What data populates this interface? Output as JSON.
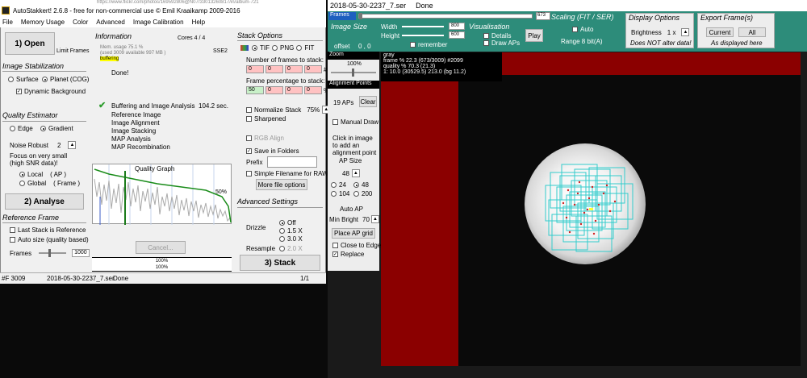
{
  "left": {
    "url_text": "https://www.flickr.com/photos/169592806@N07/33013260817/in/album-721",
    "title": "AutoStakkert! 2.6.8 - free for non-commercial use © Emil Kraaikamp 2009-2016",
    "menu": [
      "File",
      "Memory Usage",
      "Color",
      "Advanced",
      "Image Calibration",
      "Help"
    ],
    "open_label": "1) Open",
    "limit_frames_label": "Limit Frames",
    "stabilization": {
      "header": "Image Stabilization",
      "surface": "Surface",
      "planet": "Planet (COG)",
      "dynamic_bg": "Dynamic Background"
    },
    "quality": {
      "header": "Quality Estimator",
      "edge": "Edge",
      "gradient": "Gradient",
      "noise_robust_label": "Noise Robust",
      "noise_robust_value": "2",
      "focus_line1": "Focus on very small",
      "focus_line2": "(high SNR data)!",
      "local": "Local",
      "local_ap": "( AP )",
      "global": "Global",
      "global_frame": "( Frame )"
    },
    "analyse_label": "2) Analyse",
    "reference": {
      "header": "Reference Frame",
      "last_stack": "Last Stack is Reference",
      "auto_size": "Auto size (quality based)",
      "frames_label": "Frames",
      "frames_value": "1000"
    },
    "information": {
      "header": "Information",
      "cores": "Cores 4 / 4",
      "sse": "SSE2",
      "mem_usage": "Mem. usage 75.1 %",
      "mem_used": "(used 3009 available 997 MB )",
      "buffering": "buffering",
      "done": "Done!",
      "buffering_analysis": "Buffering and Image Analysis",
      "time": "104.2 sec.",
      "steps": [
        "Reference Image",
        "Image Alignment",
        "Image Stacking",
        "MAP Analysis",
        "MAP Recombination"
      ],
      "graph_title": "Quality Graph",
      "graph_percent": "50%",
      "cancel_label": "Cancel...",
      "progress1": "100%",
      "progress2": "100%"
    },
    "stack": {
      "header": "Stack Options",
      "tif": "TIF",
      "png": "PNG",
      "fit": "FIT",
      "frames_to_stack_label": "Number of frames to stack:",
      "frames_to_stack": [
        "0",
        "0",
        "0",
        "0"
      ],
      "percentage_label": "Frame percentage to stack:",
      "percentage": [
        "50",
        "0",
        "0",
        "0"
      ],
      "normalize": "Normalize Stack",
      "normalize_value": "75%",
      "sharpened": "Sharpened",
      "rgb_align": "RGB Align",
      "save_folders": "Save in Folders",
      "prefix_label": "Prefix",
      "simple_filename": "Simple Filename for RAW",
      "more_options": "More file options"
    },
    "advanced": {
      "header": "Advanced Settings",
      "drizzle_label": "Drizzle",
      "drizzle_off": "Off",
      "drizzle_15": "1.5 X",
      "drizzle_30": "3.0 X",
      "resample_label": "Resample",
      "resample_20": "2.0 X",
      "stack_label": "3) Stack"
    },
    "status": {
      "frames": "#F 3009",
      "file": "2018-05-30-2237_7.ser",
      "state": "Done",
      "page": "1/1"
    }
  },
  "right": {
    "title_file": "2018-05-30-2237_7.ser",
    "title_state": "Done",
    "frames_label": "Frames",
    "frames_value": "673",
    "image_size": {
      "header": "Image Size",
      "width_label": "Width",
      "width_value": "800",
      "height_label": "Height",
      "height_value": "600",
      "remember": "remember",
      "offset_label": "offset",
      "offset_value": "0 , 0"
    },
    "visualisation": {
      "header": "Visualisation",
      "details": "Details",
      "draw_aps": "Draw APs",
      "play": "Play"
    },
    "scaling": {
      "header": "Scaling (FIT / SER)",
      "auto": "Auto",
      "range": "Range 8 bit(A)"
    },
    "display": {
      "header": "Display Options",
      "brightness_label": "Brightness",
      "brightness_value": "1 x",
      "note": "Does NOT alter data!"
    },
    "export": {
      "header": "Export Frame(s)",
      "current": "Current",
      "all": "All",
      "note": "As displayed here"
    },
    "zoom": {
      "label": "Zoom",
      "value": "100%"
    },
    "alignment": {
      "header": "Alignment Points",
      "count": "19 APs",
      "clear": "Clear",
      "manual_draw": "Manual Draw",
      "hint1": "Click in image",
      "hint2": "to add an",
      "hint3": "alignment point",
      "ap_size_label": "AP Size",
      "ap_size_value": "48",
      "size_24": "24",
      "size_48": "48",
      "size_104": "104",
      "size_200": "200",
      "auto_ap": "Auto AP",
      "min_bright_label": "Min Bright",
      "min_bright_value": "70",
      "place_grid": "Place AP grid",
      "close_edge": "Close to Edge",
      "replace": "Replace"
    },
    "overlay": {
      "line1": "gray",
      "line2": "frame % 22.3 (673/3009) #2099",
      "line3": "quality % 70.3  (21.3)",
      "line4": "1: 10.0 (30529.5) 213.0 (bg 11.2)"
    }
  }
}
